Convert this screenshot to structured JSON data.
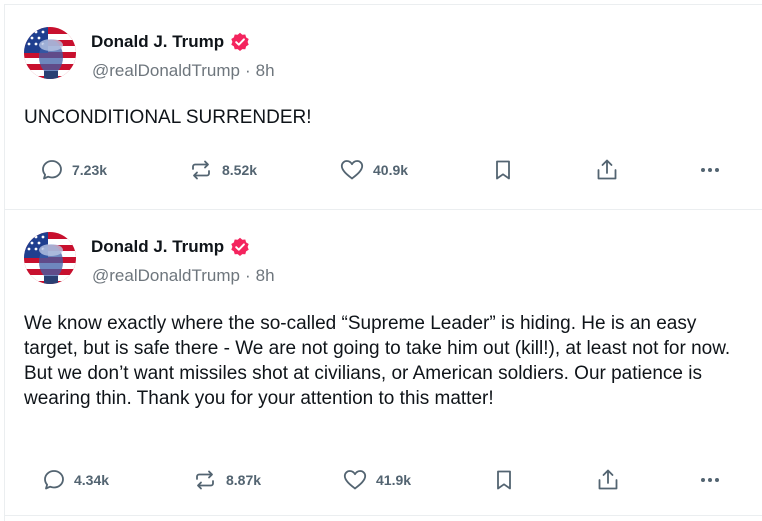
{
  "posts": [
    {
      "author_name": "Donald J. Trump",
      "handle": "@realDonaldTrump",
      "separator": "·",
      "time": "8h",
      "text": "UNCONDITIONAL SURRENDER!",
      "replies": "7.23k",
      "reposts": "8.52k",
      "likes": "40.9k"
    },
    {
      "author_name": "Donald J. Trump",
      "handle": "@realDonaldTrump",
      "separator": "·",
      "time": "8h",
      "text": "We know exactly where the so-called “Supreme Leader” is hiding. He is an easy target, but is safe there - We are not going to take him out (kill!), at least not for now. But we don’t want missiles shot at civilians, or American soldiers. Our patience is wearing thin. Thank you for your attention to this matter!",
      "replies": "4.34k",
      "reposts": "8.87k",
      "likes": "41.9k"
    }
  ],
  "icons": {
    "reply": "reply-icon",
    "repost": "repost-icon",
    "like": "heart-icon",
    "bookmark": "bookmark-icon",
    "share": "share-icon",
    "more": "more-icon",
    "verified": "verified-badge-icon"
  },
  "colors": {
    "verified_badge": "#f4245e",
    "muted_text": "#6e767d",
    "action_gray": "#536471",
    "divider": "#ebeef0"
  }
}
